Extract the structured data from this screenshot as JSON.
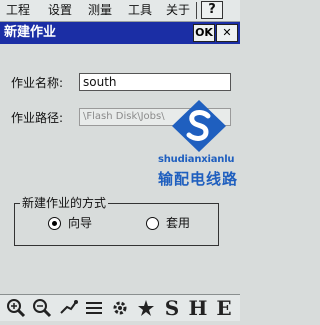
{
  "menu": {
    "items": [
      "工程",
      "设置",
      "测量",
      "工具",
      "关于"
    ],
    "help_label": "?"
  },
  "dialog": {
    "title": "新建作业",
    "ok_label": "OK",
    "close_label": "✕"
  },
  "form": {
    "name_label": "作业名称:",
    "name_value": "south",
    "path_label": "作业路径:",
    "path_value": "\\Flash Disk\\Jobs\\"
  },
  "watermark": {
    "line1": "shudianxianlu",
    "line2": "输配电线路"
  },
  "creation_method": {
    "title": "新建作业的方式",
    "options": [
      {
        "label": "向导",
        "selected": true
      },
      {
        "label": "套用",
        "selected": false
      }
    ]
  },
  "toolbar": {
    "icons": [
      "zoom-in-icon",
      "zoom-out-icon",
      "pan-icon",
      "list-icon",
      "settings-icon",
      "star-icon",
      "s-icon",
      "h-icon",
      "e-icon"
    ],
    "letters": [
      "S",
      "H",
      "E"
    ]
  },
  "colors": {
    "titlebar": "#1b2ea5",
    "watermark": "#1f5fbf"
  }
}
